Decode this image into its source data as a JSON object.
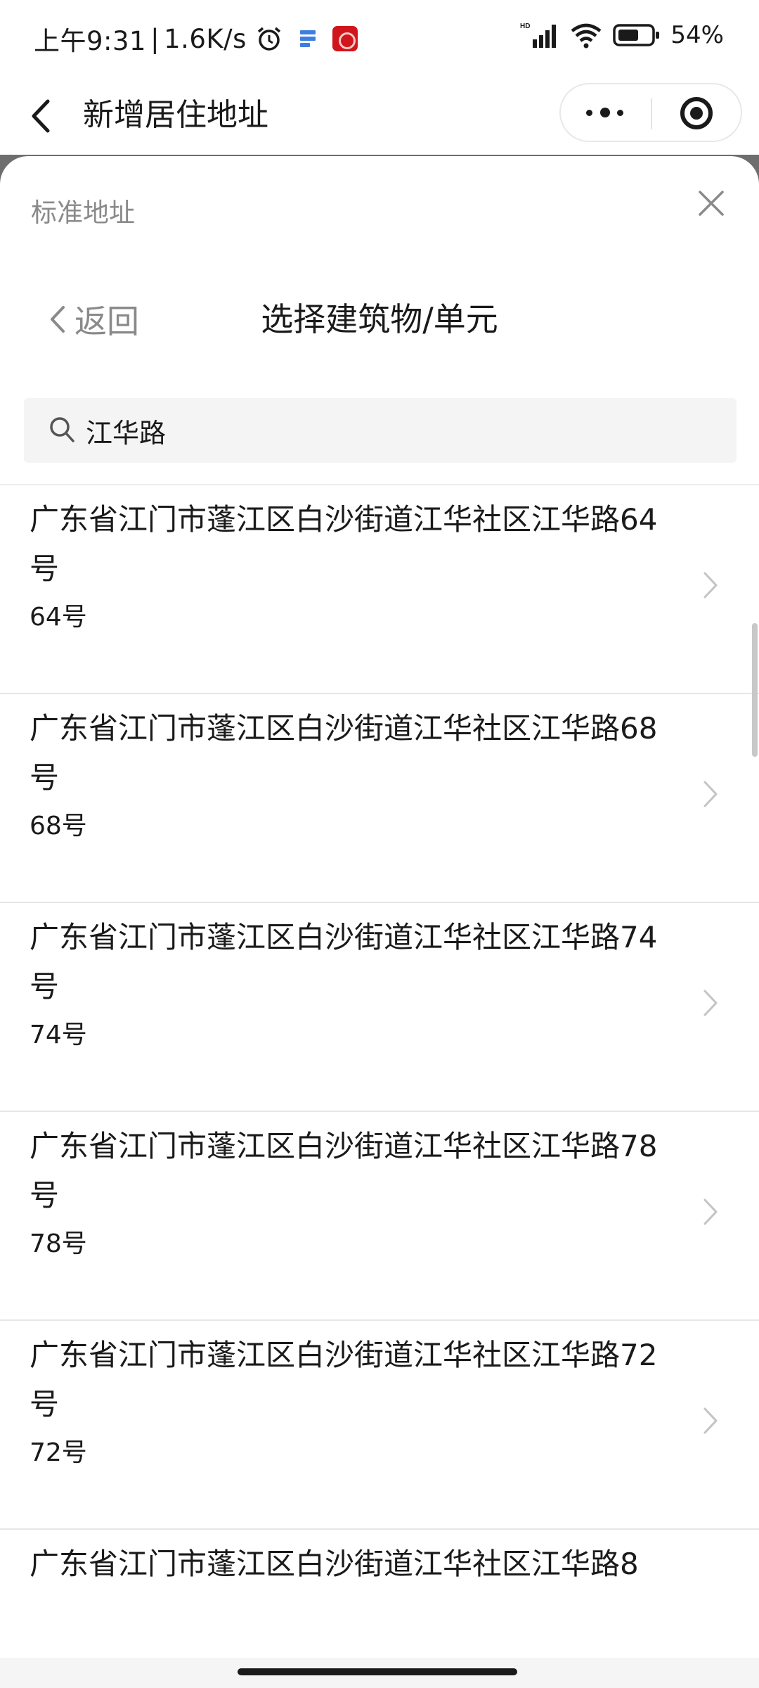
{
  "status_bar": {
    "time": "上午9:31",
    "net_speed": "1.6K/s",
    "separator": "|",
    "battery": "54%",
    "icons": [
      "alarm-icon",
      "app-notification-icon",
      "app-notification-icon-red",
      "signal-icon",
      "wifi-icon",
      "battery-icon"
    ]
  },
  "header": {
    "title": "新增居住地址",
    "icons": [
      "back-arrow-icon",
      "more-icon",
      "close-miniprogram-icon"
    ]
  },
  "sheet": {
    "label": "标准地址",
    "return_label": "返回",
    "title": "选择建筑物/单元",
    "close_icon": "close-icon"
  },
  "search": {
    "value": "江华路",
    "icon": "search-icon"
  },
  "list": {
    "items": [
      {
        "title": "广东省江门市蓬江区白沙街道江华社区江华路64号",
        "subtitle": "64号"
      },
      {
        "title": "广东省江门市蓬江区白沙街道江华社区江华路68号",
        "subtitle": "68号"
      },
      {
        "title": "广东省江门市蓬江区白沙街道江华社区江华路74号",
        "subtitle": "74号"
      },
      {
        "title": "广东省江门市蓬江区白沙街道江华社区江华路78号",
        "subtitle": "78号"
      },
      {
        "title": "广东省江门市蓬江区白沙街道江华社区江华路72号",
        "subtitle": "72号"
      },
      {
        "title": "广东省江门市蓬江区白沙街道江华社区江华路8",
        "subtitle": ""
      }
    ]
  },
  "colors": {
    "text_primary": "#1a1a1a",
    "text_secondary": "#8a8a8a",
    "search_bg": "#f4f4f4",
    "divider": "#e6e6e6",
    "overlay": "#6e6e6e"
  }
}
